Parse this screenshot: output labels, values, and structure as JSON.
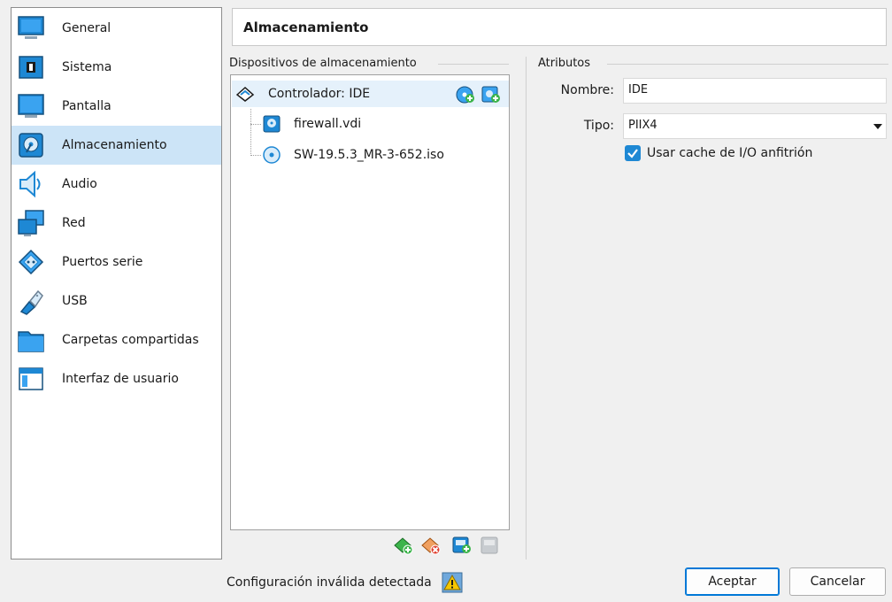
{
  "sidebar": {
    "items": [
      {
        "label": "General",
        "icon": "monitor-icon"
      },
      {
        "label": "Sistema",
        "icon": "chip-icon"
      },
      {
        "label": "Pantalla",
        "icon": "display-icon"
      },
      {
        "label": "Almacenamiento",
        "icon": "disk-icon"
      },
      {
        "label": "Audio",
        "icon": "speaker-icon"
      },
      {
        "label": "Red",
        "icon": "network-icon"
      },
      {
        "label": "Puertos serie",
        "icon": "serial-port-icon"
      },
      {
        "label": "USB",
        "icon": "usb-icon"
      },
      {
        "label": "Carpetas compartidas",
        "icon": "folder-icon"
      },
      {
        "label": "Interfaz de usuario",
        "icon": "window-icon"
      }
    ],
    "selected": "Almacenamiento"
  },
  "header": {
    "title": "Almacenamiento"
  },
  "storage": {
    "group_title": "Dispositivos de almacenamiento",
    "controller": "Controlador: IDE",
    "devices": [
      "firewall.vdi",
      "SW-19.5.3_MR-3-652.iso"
    ]
  },
  "attributes": {
    "group_title": "Atributos",
    "name_label": "Nombre:",
    "name_value": "IDE",
    "type_label": "Tipo:",
    "type_value": "PIIX4",
    "cache_label": "Usar cache de I/O anfitrión",
    "cache_checked": true
  },
  "footer": {
    "status": "Configuración inválida detectada",
    "ok_label": "Aceptar",
    "cancel_label": "Cancelar"
  },
  "colors": {
    "selection": "#cce4f7",
    "accent": "#0078d7",
    "icon_blue": "#1e88d4"
  }
}
